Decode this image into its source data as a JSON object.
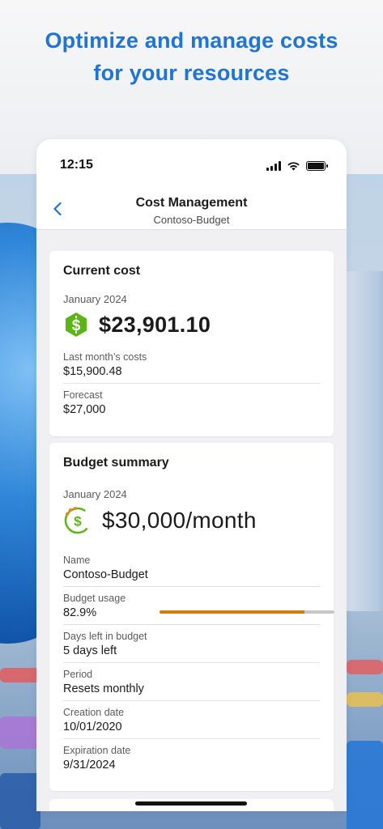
{
  "headline": {
    "line1": "Optimize and manage costs",
    "line2": "for your resources"
  },
  "status_bar": {
    "time": "12:15",
    "icons": [
      "cellular-signal-icon",
      "wifi-icon",
      "battery-icon"
    ]
  },
  "nav": {
    "back_icon": "chevron-left-icon",
    "title": "Cost Management",
    "subtitle": "Contoso-Budget"
  },
  "current_cost": {
    "title": "Current cost",
    "period": "January 2024",
    "icon": "dollar-hexagon-icon",
    "amount": "$23,901.10",
    "fields": [
      {
        "label": "Last month’s costs",
        "value": "$15,900.48"
      },
      {
        "label": "Forecast",
        "value": "$27,000"
      }
    ]
  },
  "budget_summary": {
    "title": "Budget summary",
    "period": "January 2024",
    "icon": "dollar-cycle-icon",
    "amount": "$30,000/month",
    "fields": [
      {
        "label": "Name",
        "value": "Contoso-Budget"
      },
      {
        "label": "Budget usage",
        "value": "82.9%",
        "progress_fraction": 0.829
      },
      {
        "label": "Days left in budget",
        "value": "5 days left"
      },
      {
        "label": "Period",
        "value": "Resets monthly"
      },
      {
        "label": "Creation date",
        "value": "10/01/2020"
      },
      {
        "label": "Expiration date",
        "value": "9/31/2024"
      }
    ]
  },
  "colors": {
    "headline": "#1f74d4",
    "accent_blue": "#1f74d4",
    "cost_icon_green": "#5cb516",
    "usage_bar_fill": "#d17d0a",
    "usage_bar_track": "#c8c8cc"
  }
}
